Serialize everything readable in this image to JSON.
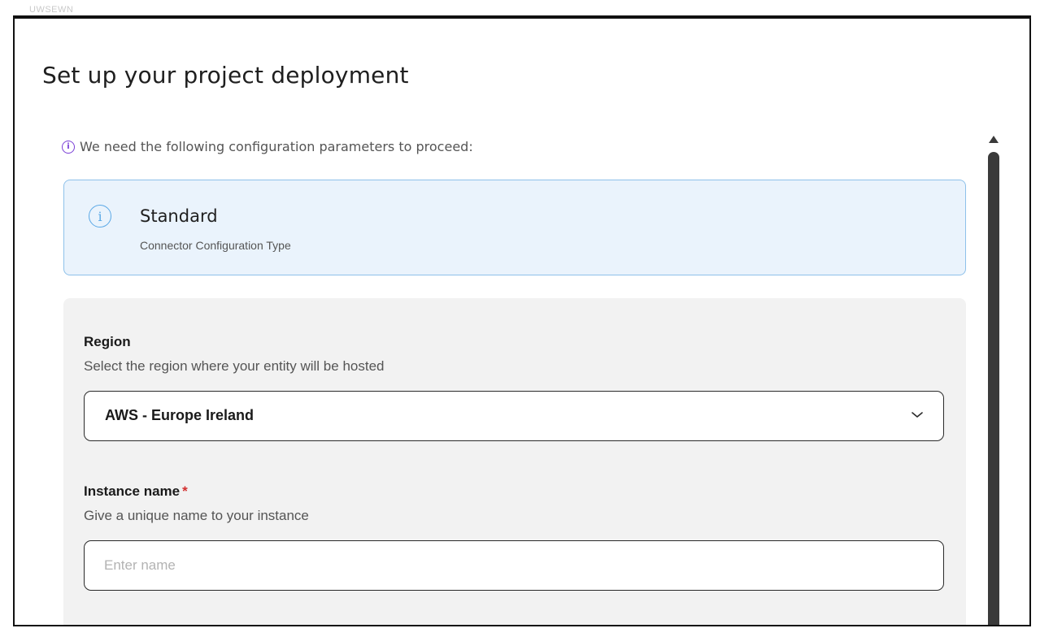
{
  "backdrop": {
    "text": "UWSEWN"
  },
  "modal": {
    "title": "Set up your project deployment",
    "notice": "We need the following configuration parameters to proceed:",
    "notice_icon": "info-icon",
    "config_card": {
      "icon": "info-icon",
      "title": "Standard",
      "subtitle": "Connector Configuration Type"
    },
    "form": {
      "region": {
        "label": "Region",
        "help": "Select the region where your entity will be hosted",
        "value": "AWS - Europe Ireland",
        "icon": "chevron-down-icon"
      },
      "instance_name": {
        "label": "Instance name",
        "required_mark": "*",
        "help": "Give a unique name to your instance",
        "value": "",
        "placeholder": "Enter name"
      }
    }
  },
  "colors": {
    "accent_purple": "#7a3fd6",
    "info_blue": "#5aa8e6",
    "card_bg": "#eaf3fc",
    "panel_bg": "#f2f2f2",
    "required_red": "#d32f2f"
  }
}
